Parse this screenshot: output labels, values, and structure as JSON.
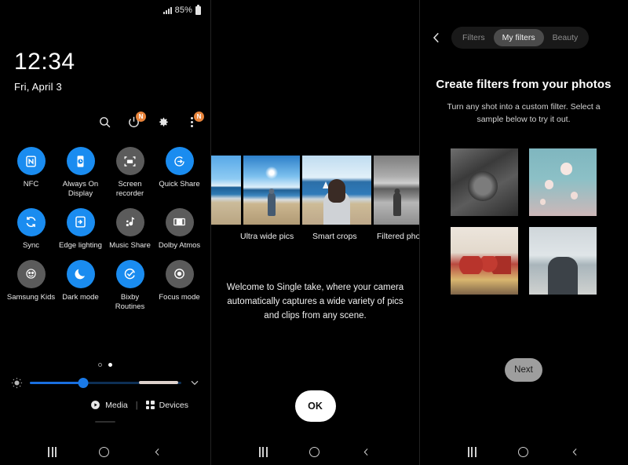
{
  "panel1": {
    "status": {
      "battery": "85%",
      "signal_icon": "signal-bars-icon",
      "battery_icon": "battery-icon"
    },
    "clock": {
      "time": "12:34",
      "date": "Fri, April 3"
    },
    "header_icons": [
      {
        "name": "search-icon",
        "badge": ""
      },
      {
        "name": "power-icon",
        "badge": "N"
      },
      {
        "name": "gear-icon",
        "badge": ""
      },
      {
        "name": "overflow-menu-icon",
        "badge": "N"
      }
    ],
    "tiles": [
      {
        "label": "NFC",
        "icon": "nfc-icon",
        "state": "on"
      },
      {
        "label": "Always On Display",
        "icon": "always-on-display-icon",
        "state": "on"
      },
      {
        "label": "Screen recorder",
        "icon": "screen-recorder-icon",
        "state": "off"
      },
      {
        "label": "Quick Share",
        "icon": "quick-share-icon",
        "state": "on"
      },
      {
        "label": "Sync",
        "icon": "sync-icon",
        "state": "on"
      },
      {
        "label": "Edge lighting",
        "icon": "edge-lighting-icon",
        "state": "on"
      },
      {
        "label": "Music Share",
        "icon": "music-share-icon",
        "state": "off"
      },
      {
        "label": "Dolby Atmos",
        "icon": "dolby-atmos-icon",
        "state": "off"
      },
      {
        "label": "Samsung Kids",
        "icon": "samsung-kids-icon",
        "state": "off"
      },
      {
        "label": "Dark mode",
        "icon": "dark-mode-icon",
        "state": "on"
      },
      {
        "label": "Bixby Routines",
        "icon": "bixby-routines-icon",
        "state": "on"
      },
      {
        "label": "Focus mode",
        "icon": "focus-mode-icon",
        "state": "off"
      }
    ],
    "page_dots": {
      "total": 2,
      "active_index": 1
    },
    "brightness": {
      "icon": "brightness-icon",
      "value_percent": 35,
      "expand_icon": "chevron-down-icon"
    },
    "footer": {
      "media_label": "Media",
      "devices_label": "Devices",
      "separator": "|"
    },
    "colors": {
      "tile_on": "#1a8cf0",
      "tile_off": "#5b5b5b",
      "badge": "#e8833a",
      "slider": "#1a7ae8"
    }
  },
  "panel2": {
    "cards": [
      {
        "caption": ""
      },
      {
        "caption": "Ultra wide pics"
      },
      {
        "caption": "Smart crops"
      },
      {
        "caption": "Filtered pho"
      }
    ],
    "welcome_text": "Welcome to Single take, where your camera automatically captures a wide variety of pics and clips from any scene.",
    "ok_label": "OK"
  },
  "panel3": {
    "back_icon": "back-chevron-icon",
    "tabs": [
      {
        "label": "Filters",
        "active": false
      },
      {
        "label": "My filters",
        "active": true
      },
      {
        "label": "Beauty",
        "active": false
      }
    ],
    "title": "Create filters from your photos",
    "subtitle": "Turn any shot into a custom filter. Select a sample below to try it out.",
    "photos": [
      {
        "name": "photo-food-bw"
      },
      {
        "name": "photo-blossom"
      },
      {
        "name": "photo-strawberry-tart"
      },
      {
        "name": "photo-beach-celebration"
      }
    ],
    "next_label": "Next",
    "colors": {
      "tabbar_bg": "#191919",
      "tab_active_bg": "#4b4b4b",
      "next_bg": "#9e9e9e"
    }
  },
  "navbar": {
    "recents_icon": "recents-icon",
    "home_icon": "home-icon",
    "back_icon": "back-icon"
  }
}
